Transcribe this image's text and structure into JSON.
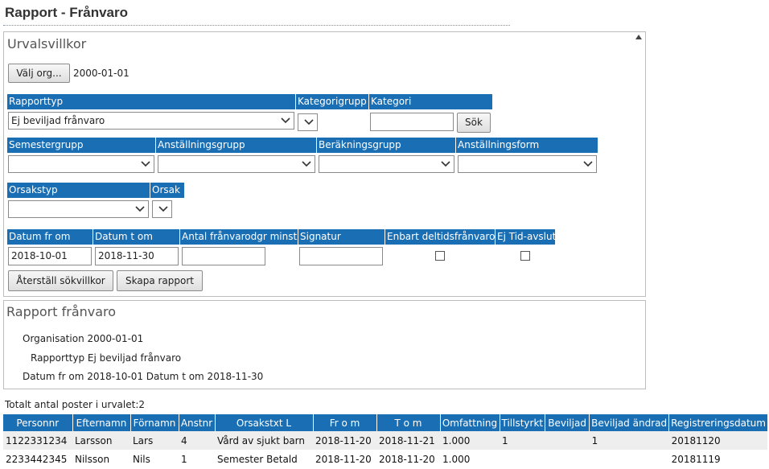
{
  "page": {
    "title": "Rapport - Frånvaro"
  },
  "criteria": {
    "title": "Urvalsvillkor",
    "org_button": "Välj org...",
    "org_value": "2000-01-01",
    "rapporttyp": {
      "label": "Rapporttyp",
      "value": "Ej beviljad frånvaro"
    },
    "kategorigrupp": {
      "label": "Kategorigrupp",
      "value": ""
    },
    "kategori": {
      "label": "Kategori",
      "value": ""
    },
    "search_button": "Sök",
    "semestergrupp": {
      "label": "Semestergrupp",
      "value": ""
    },
    "anstallningsgrupp": {
      "label": "Anställningsgrupp",
      "value": ""
    },
    "berakningsgrupp": {
      "label": "Beräkningsgrupp",
      "value": ""
    },
    "anstallningsform": {
      "label": "Anställningsform",
      "value": ""
    },
    "orsakstyp": {
      "label": "Orsakstyp",
      "value": ""
    },
    "orsak": {
      "label": "Orsak",
      "value": ""
    },
    "datum_from": {
      "label": "Datum fr om",
      "value": "2018-10-01"
    },
    "datum_tom": {
      "label": "Datum t om",
      "value": "2018-11-30"
    },
    "antal_min": {
      "label": "Antal frånvarodgr minst",
      "value": ""
    },
    "signatur": {
      "label": "Signatur",
      "value": ""
    },
    "enbart_deltid": {
      "label": "Enbart deltidsfrånvaro",
      "checked": false
    },
    "ej_tid_avslut": {
      "label": "Ej Tid-avslut",
      "checked": false
    },
    "reset_button": "Återställ sökvillkor",
    "create_button": "Skapa rapport"
  },
  "report": {
    "title": "Rapport frånvaro",
    "lines": [
      "Organisation 2000-01-01",
      "Rapporttyp Ej beviljad frånvaro",
      "Datum fr om 2018-10-01 Datum t om 2018-11-30"
    ]
  },
  "results": {
    "total": "Totalt antal poster i urvalet:2",
    "columns": [
      "Personnr",
      "Efternamn",
      "Förnamn",
      "Anstnr",
      "Orsakstxt L",
      "Fr o m",
      "T o m",
      "Omfattning",
      "Tillstyrkt",
      "Beviljad",
      "Beviljad ändrad",
      "Registreringsdatum"
    ],
    "rows": [
      [
        "1122331234",
        "Larsson",
        "Lars",
        "4",
        "Vård av sjukt barn",
        "2018-11-20",
        "2018-11-21",
        "1.000",
        "1",
        "",
        "1",
        "20181120"
      ],
      [
        "2233442345",
        "Nilsson",
        "Nils",
        "1",
        "Semester Betald",
        "2018-11-20",
        "2018-11-20",
        "1.000",
        "",
        "",
        "",
        "20181119"
      ]
    ]
  },
  "icons": {
    "dropdown": "chevron-down-icon",
    "collapse": "triangle-up-icon"
  }
}
